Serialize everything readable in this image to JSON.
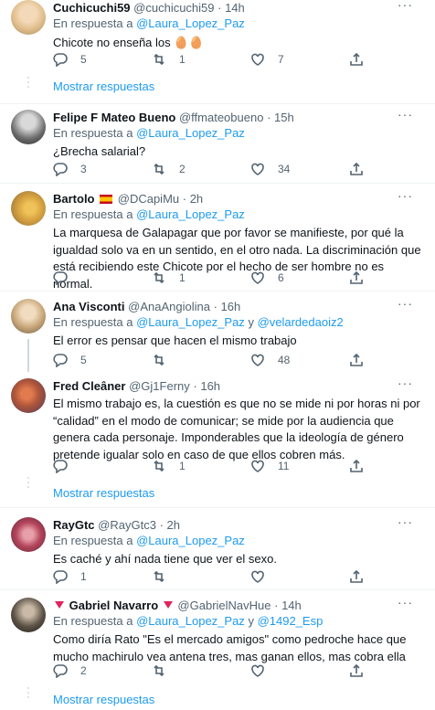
{
  "reply_prefix": "En respuesta a",
  "and_word": "y",
  "show_replies_label": "Mostrar respuestas",
  "more_icon": "···",
  "tweets": [
    {
      "name": "Cuchicuchi59",
      "handle": "@cuchicuchi59",
      "time": "· 14h",
      "mention1": "@Laura_Lopez_Paz",
      "mention2": "",
      "text": "Chicote no enseña los 🥚🥚",
      "replies": "5",
      "retweets": "1",
      "likes": "7",
      "avatar_color": "#e3c08f"
    },
    {
      "name": "Felipe F Mateo Bueno",
      "handle": "@ffmateobueno",
      "time": "· 15h",
      "mention1": "@Laura_Lopez_Paz",
      "mention2": "",
      "text": "¿Brecha salarial?",
      "replies": "3",
      "retweets": "2",
      "likes": "34",
      "avatar_color": "#6b6b6b"
    },
    {
      "name": "Bartolo",
      "handle": "@DCapiMu",
      "time": "· 2h",
      "mention1": "@Laura_Lopez_Paz",
      "mention2": "",
      "text": "La marquesa de Galapagar que por favor se manifieste, por qué la igualdad solo va en un sentido, en el otro nada. La discriminación que está recibiendo este Chicote por el hecho de ser hombre no es normal.",
      "replies": "",
      "retweets": "1",
      "likes": "6",
      "avatar_color": "#d9a441"
    },
    {
      "name": "Ana Visconti",
      "handle": "@AnaAngiolina",
      "time": "· 16h",
      "mention1": "@Laura_Lopez_Paz",
      "mention2": "@velardedaoiz2",
      "text": "El error es pensar que hacen el mismo trabajo",
      "replies": "5",
      "retweets": "",
      "likes": "48",
      "avatar_color": "#c8a77a"
    },
    {
      "name": "Fred Cleâner",
      "handle": "@Gj1Ferny",
      "time": "· 16h",
      "mention1": "",
      "mention2": "",
      "text": "El mismo trabajo es, la cuestión es que no se mide ni por horas ni por “calidad” en el modo de comunicar; se mide por la audiencia que genera cada personaje. Imponderables que la ideología de género pretende igualar solo en caso de que ellos cobren más.",
      "replies": "",
      "retweets": "1",
      "likes": "11",
      "avatar_color": "#b0563a"
    },
    {
      "name": "RayGtc",
      "handle": "@RayGtc3",
      "time": "· 2h",
      "mention1": "@Laura_Lopez_Paz",
      "mention2": "",
      "text": "Es caché y ahí nada tiene que ver el sexo.",
      "replies": "1",
      "retweets": "",
      "likes": "",
      "avatar_color": "#b4455c"
    },
    {
      "name": "Gabriel Navarro",
      "handle": "@GabrielNavHue",
      "time": "· 14h",
      "mention1": "@Laura_Lopez_Paz",
      "mention2": "@1492_Esp",
      "text": "Como diría Rato \"Es el mercado amigos\" como pedroche hace que mucho machirulo vea antena tres, mas ganan ellos, mas cobra ella",
      "replies": "2",
      "retweets": "",
      "likes": "",
      "avatar_color": "#5d5347"
    }
  ]
}
